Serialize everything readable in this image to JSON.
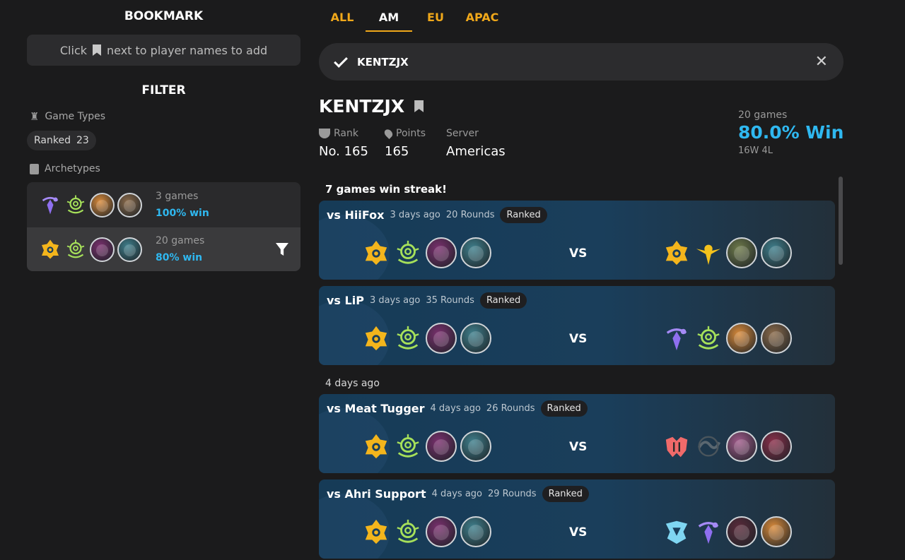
{
  "bookmark": {
    "title": "BOOKMARK",
    "hint_prefix": "Click",
    "hint_suffix": "next to player names to add"
  },
  "filter": {
    "title": "FILTER",
    "game_types_label": "Game Types",
    "ranked_pill": {
      "label": "Ranked",
      "count": "23"
    },
    "archetypes_label": "Archetypes",
    "archetypes": [
      {
        "games": "3 games",
        "win": "100% win",
        "traits": [
          "purple-mage",
          "green-swirl"
        ],
        "champions": [
          "#d98a3a",
          "#8a6a4a"
        ]
      },
      {
        "games": "20 games",
        "win": "80% win",
        "traits": [
          "gold-shield",
          "green-swirl"
        ],
        "champions": [
          "#7a2f6e",
          "#3f7f8c"
        ]
      }
    ]
  },
  "tabs": [
    "ALL",
    "AM",
    "EU",
    "APAC"
  ],
  "search": {
    "value": "KENTZJX"
  },
  "player": {
    "name": "KENTZJX",
    "rank_label": "Rank",
    "rank_value": "No. 165",
    "points_label": "Points",
    "points_value": "165",
    "server_label": "Server",
    "server_value": "Americas",
    "games": "20 games",
    "win_pct": "80.0% Win",
    "wl": "16W 4L"
  },
  "colors": {
    "accent": "#f0a81a",
    "win_blue": "#2fb8f0",
    "bg": "#1b1b1c",
    "card": "#2c2c2e"
  },
  "matches": {
    "group1_label": "7 games win streak!",
    "group2_label": "4 days ago",
    "vs_label": "VS",
    "list": [
      {
        "opponent": "vs HiiFox",
        "time": "3 days ago",
        "rounds": "20 Rounds",
        "type": "Ranked",
        "my_traits": [
          "gold-shield",
          "green-swirl"
        ],
        "my_champs": [
          "#7a2f6e",
          "#3f7f8c"
        ],
        "opp_traits": [
          "gold-shield",
          "gold-star"
        ],
        "opp_champs": [
          "#6e7a4a",
          "#3f7f8c"
        ]
      },
      {
        "opponent": "vs LiP",
        "time": "3 days ago",
        "rounds": "35 Rounds",
        "type": "Ranked",
        "my_traits": [
          "gold-shield",
          "green-swirl"
        ],
        "my_champs": [
          "#7a2f6e",
          "#3f7f8c"
        ],
        "opp_traits": [
          "purple-mage",
          "green-swirl"
        ],
        "opp_champs": [
          "#d98a3a",
          "#8a6a4a"
        ]
      },
      {
        "opponent": "vs Meat Tugger",
        "time": "4 days ago",
        "rounds": "26 Rounds",
        "type": "Ranked",
        "my_traits": [
          "gold-shield",
          "green-swirl"
        ],
        "my_champs": [
          "#7a2f6e",
          "#3f7f8c"
        ],
        "opp_traits": [
          "red-crest",
          "grey-wave"
        ],
        "opp_champs": [
          "#a05a8a",
          "#8a2f4a"
        ]
      },
      {
        "opponent": "vs Ahri Support",
        "time": "4 days ago",
        "rounds": "29 Rounds",
        "type": "Ranked",
        "my_traits": [
          "gold-shield",
          "green-swirl"
        ],
        "my_champs": [
          "#7a2f6e",
          "#3f7f8c"
        ],
        "opp_traits": [
          "blue-crest",
          "purple-mage"
        ],
        "opp_champs": [
          "#5a2a3a",
          "#d98a3a"
        ]
      }
    ]
  }
}
